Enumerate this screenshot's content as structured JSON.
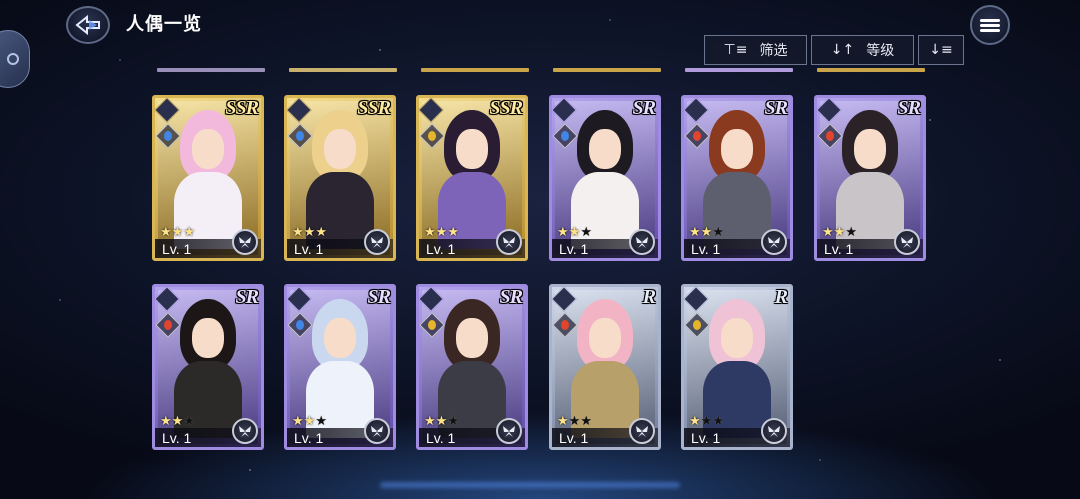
{
  "header": {
    "title": "人偶一览",
    "filter_label": "筛选",
    "sort_label": "等级",
    "back_icon": "back-arrow-icon",
    "menu_icon": "hamburger-menu-icon"
  },
  "colors": {
    "ssr_frame": "#d8b654",
    "sr_frame": "#9f8ce0",
    "r_frame": "#a9b4cc"
  },
  "cards": [
    {
      "rarity": "SSR",
      "level": "Lv. 1",
      "stars": 3,
      "element": "water",
      "hair": "#f2b9dd",
      "body": "#f4eef6"
    },
    {
      "rarity": "SSR",
      "level": "Lv. 1",
      "stars": 3,
      "element": "water",
      "hair": "#ecd08c",
      "body": "#2a2530"
    },
    {
      "rarity": "SSR",
      "level": "Lv. 1",
      "stars": 3,
      "element": "light",
      "hair": "#2a1d33",
      "body": "#7d64b8"
    },
    {
      "rarity": "SR",
      "level": "Lv. 1",
      "stars": 2,
      "element": "water",
      "hair": "#1e1a22",
      "body": "#f4f0f0"
    },
    {
      "rarity": "SR",
      "level": "Lv. 1",
      "stars": 2,
      "element": "fire",
      "hair": "#8a3a1e",
      "body": "#5d5f6e"
    },
    {
      "rarity": "SR",
      "level": "Lv. 1",
      "stars": 2,
      "element": "fire",
      "hair": "#2b2228",
      "body": "#c9c4c8"
    },
    {
      "rarity": "SR",
      "level": "Lv. 1",
      "stars": 2,
      "element": "fire",
      "hair": "#1c1716",
      "body": "#2c2a28"
    },
    {
      "rarity": "SR",
      "level": "Lv. 1",
      "stars": 2,
      "element": "water",
      "hair": "#c9d8ef",
      "body": "#eef2fa"
    },
    {
      "rarity": "SR",
      "level": "Lv. 1",
      "stars": 2,
      "element": "light",
      "hair": "#3a2724",
      "body": "#3c3c46"
    },
    {
      "rarity": "R",
      "level": "Lv. 1",
      "stars": 1,
      "element": "fire",
      "hair": "#f2b4c4",
      "body": "#b8a06a"
    },
    {
      "rarity": "R",
      "level": "Lv. 1",
      "stars": 1,
      "element": "light",
      "hair": "#f0c2d6",
      "body": "#2e3a64"
    }
  ]
}
